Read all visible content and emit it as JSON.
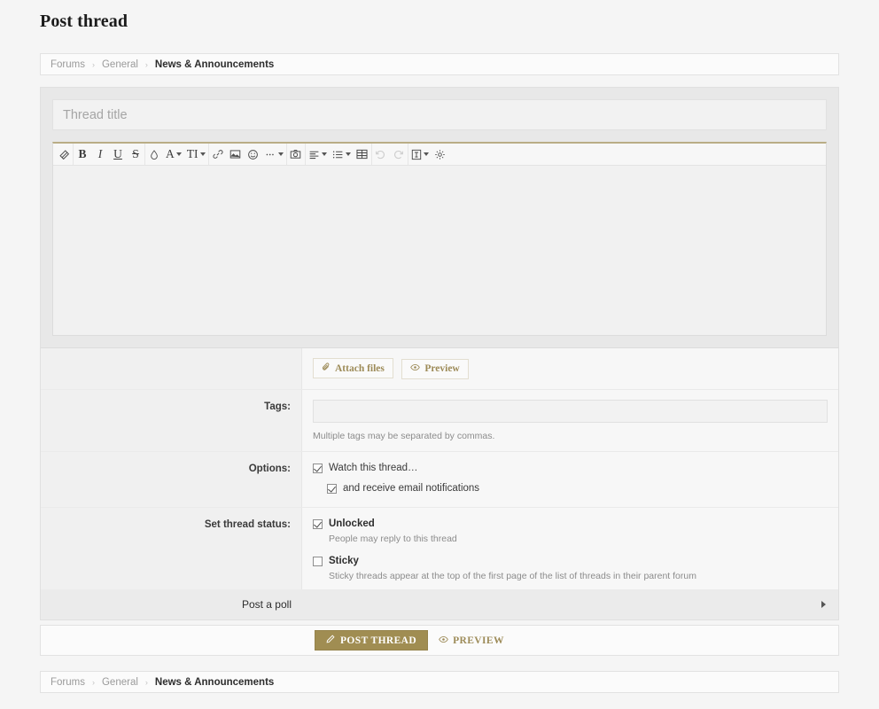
{
  "page": {
    "title": "Post thread"
  },
  "breadcrumb": {
    "items": [
      {
        "label": "Forums",
        "current": false
      },
      {
        "label": "General",
        "current": false
      },
      {
        "label": "News & Announcements",
        "current": true
      }
    ],
    "separator": "›"
  },
  "compose": {
    "title_placeholder": "Thread title",
    "title_value": "",
    "accent_color": "#b9ad86"
  },
  "toolbar": {
    "groups": [
      {
        "buttons": [
          {
            "name": "remove-formatting-icon",
            "label": "",
            "glyph": "eraser",
            "caret": false,
            "disabled": false
          }
        ]
      },
      {
        "buttons": [
          {
            "name": "bold-button",
            "label": "B",
            "glyph": "text-bold",
            "caret": false,
            "disabled": false
          },
          {
            "name": "italic-button",
            "label": "I",
            "glyph": "text-italic",
            "caret": false,
            "disabled": false
          },
          {
            "name": "underline-button",
            "label": "U",
            "glyph": "text-underline",
            "caret": false,
            "disabled": false
          },
          {
            "name": "strikethrough-button",
            "label": "S",
            "glyph": "text-strike",
            "caret": false,
            "disabled": false
          }
        ]
      },
      {
        "buttons": [
          {
            "name": "text-color-icon",
            "label": "",
            "glyph": "droplet",
            "caret": false,
            "disabled": false
          },
          {
            "name": "font-family-button",
            "label": "A",
            "glyph": "text-plain",
            "caret": true,
            "disabled": false
          },
          {
            "name": "font-size-button",
            "label": "TI",
            "glyph": "text-plain",
            "caret": true,
            "disabled": false
          }
        ]
      },
      {
        "buttons": [
          {
            "name": "insert-link-icon",
            "label": "",
            "glyph": "link",
            "caret": false,
            "disabled": false
          },
          {
            "name": "insert-image-icon",
            "label": "",
            "glyph": "image",
            "caret": false,
            "disabled": false
          },
          {
            "name": "insert-smilie-icon",
            "label": "",
            "glyph": "smiley",
            "caret": false,
            "disabled": false
          },
          {
            "name": "more-options-button",
            "label": "",
            "glyph": "ellipsis",
            "caret": true,
            "disabled": false
          }
        ]
      },
      {
        "buttons": [
          {
            "name": "insert-media-icon",
            "label": "",
            "glyph": "camera",
            "caret": false,
            "disabled": false
          }
        ]
      },
      {
        "buttons": [
          {
            "name": "alignment-button",
            "label": "",
            "glyph": "align",
            "caret": true,
            "disabled": false
          },
          {
            "name": "list-button",
            "label": "",
            "glyph": "list",
            "caret": true,
            "disabled": false
          },
          {
            "name": "insert-table-icon",
            "label": "",
            "glyph": "table",
            "caret": false,
            "disabled": false
          }
        ]
      },
      {
        "buttons": [
          {
            "name": "undo-button",
            "label": "",
            "glyph": "undo",
            "caret": false,
            "disabled": true
          },
          {
            "name": "redo-button",
            "label": "",
            "glyph": "redo",
            "caret": false,
            "disabled": true
          }
        ]
      },
      {
        "buttons": [
          {
            "name": "drafts-button",
            "label": "",
            "glyph": "draft",
            "caret": true,
            "disabled": false
          },
          {
            "name": "editor-settings-icon",
            "label": "",
            "glyph": "gear",
            "caret": false,
            "disabled": false
          }
        ]
      }
    ]
  },
  "actions": {
    "attach_files_label": "Attach files",
    "preview_label": "Preview"
  },
  "tags": {
    "label": "Tags:",
    "value": "",
    "placeholder": "",
    "hint": "Multiple tags may be separated by commas."
  },
  "options": {
    "label": "Options:",
    "watch_thread": {
      "label": "Watch this thread…",
      "checked": true
    },
    "email_notifications": {
      "label": "and receive email notifications",
      "checked": true
    }
  },
  "thread_status": {
    "label": "Set thread status:",
    "unlocked": {
      "label": "Unlocked",
      "checked": true,
      "description": "People may reply to this thread"
    },
    "sticky": {
      "label": "Sticky",
      "checked": false,
      "description": "Sticky threads appear at the top of the first page of the list of threads in their parent forum"
    }
  },
  "poll": {
    "label": "Post a poll"
  },
  "submit": {
    "post_thread_label": "POST THREAD",
    "preview_label": "PREVIEW",
    "primary_color": "#a08d52"
  }
}
